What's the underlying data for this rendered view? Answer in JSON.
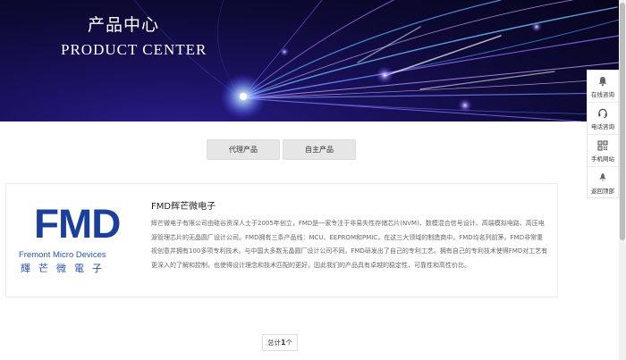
{
  "banner": {
    "title": "产品中心",
    "subtitle": "PRODUCT CENTER"
  },
  "side_bar": {
    "items": [
      {
        "label": "在线咨询",
        "icon": "bell-icon"
      },
      {
        "label": "电话咨询",
        "icon": "headset-icon"
      },
      {
        "label": "手机网站",
        "icon": "qr-code-icon"
      },
      {
        "label": "返回顶部",
        "icon": "rocket-icon"
      }
    ]
  },
  "tabs": [
    {
      "label": "代理产品"
    },
    {
      "label": "自主产品"
    }
  ],
  "product": {
    "logo_text": "FMD",
    "logo_en": "Fremont Micro Devices",
    "logo_cn": "輝芒微電子",
    "title": "FMD辉芒微电子",
    "description": "辉芒微电子有限公司由硅谷资深人士于2005年创立，FMD是一家专注于非易失性存储芯片(NVM)、数模混合信号设计、高端模拟电路、高压电源管理芯片的无晶圆厂设计公司。FMD拥有三条产品线：MCU、EEPROM和PMIC，在这三大领域的制造商中，FMD均名列前茅。FMD非常重视创意并拥有100多项专利技术。与中国大多数无晶圆厂设计公司不同，FMD研发出了自己的专利工艺。拥有自己的专利技术使得FMD对工艺有更深入的了解和控制，也使得设计理念和技术匹配的更好，因此我们的产品具有卓越的稳定性、可靠性和高性价比。"
  },
  "pagination": {
    "prefix": "总计",
    "count": "1",
    "suffix": "个"
  },
  "colors": {
    "brand_blue": "#1b3f9b",
    "banner_dark": "#07051d"
  }
}
